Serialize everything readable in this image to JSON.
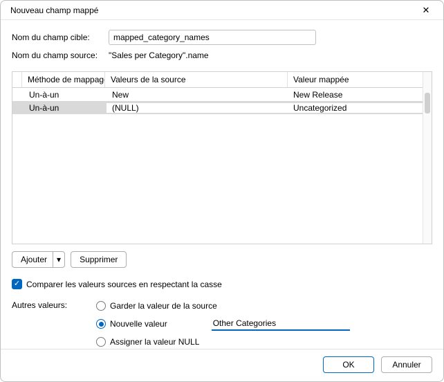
{
  "window": {
    "title": "Nouveau champ mappé"
  },
  "labels": {
    "target_field": "Nom du champ cible:",
    "source_field": "Nom du champ source:",
    "other_values": "Autres valeurs:"
  },
  "fields": {
    "target_value": "mapped_category_names",
    "source_value": "\"Sales per Category\".name"
  },
  "table": {
    "headers": {
      "method": "Méthode de mappage",
      "source": "Valeurs de la source",
      "mapped": "Valeur mappée"
    },
    "rows": [
      {
        "method": "Un-à-un",
        "source": "New",
        "mapped": "New Release",
        "selected": false
      },
      {
        "method": "Un-à-un",
        "source": "(NULL)",
        "mapped": "Uncategorized",
        "selected": true
      }
    ]
  },
  "buttons": {
    "add": "Ajouter",
    "delete": "Supprimer",
    "ok": "OK",
    "cancel": "Annuler"
  },
  "checkbox": {
    "case_sensitive": "Comparer les valeurs sources en respectant la casse",
    "case_sensitive_checked": true
  },
  "radios": {
    "keep_source": "Garder la valeur de la source",
    "new_value": "Nouvelle valeur",
    "assign_null": "Assigner la valeur NULL",
    "selected": "new_value",
    "new_value_text": "Other Categories"
  }
}
